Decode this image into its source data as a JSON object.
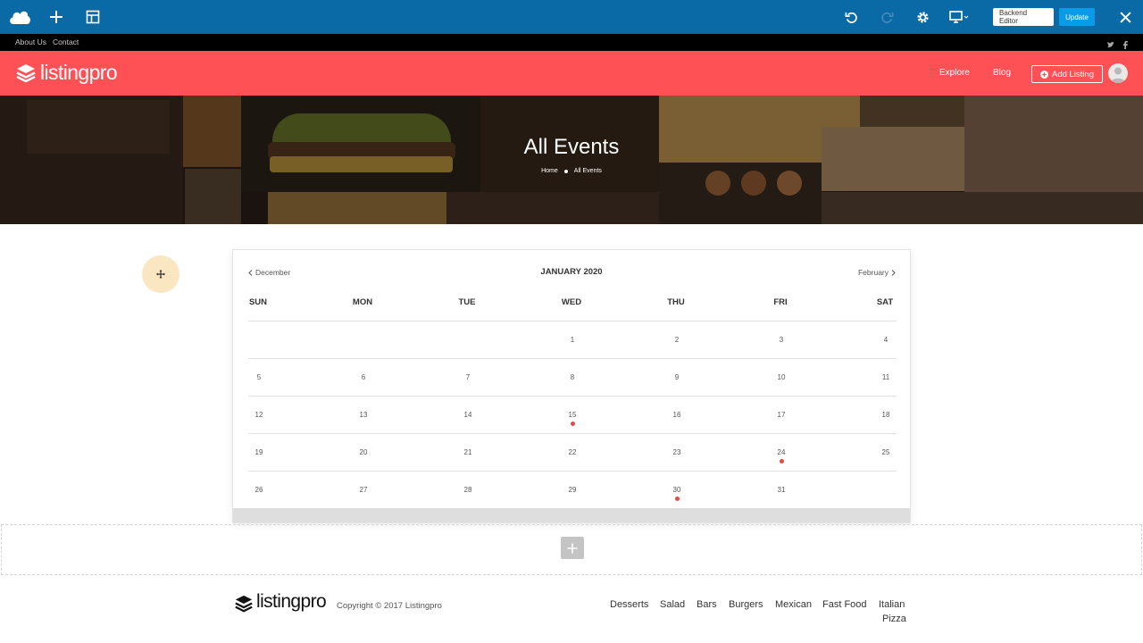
{
  "editor": {
    "backend_label": "Backend Editor",
    "update_label": "Update"
  },
  "topbar": {
    "links": [
      "About Us",
      "Contact"
    ]
  },
  "header": {
    "logo_text": "listingpro",
    "nav": [
      "Explore",
      "Blog"
    ],
    "add_listing_label": "Add Listing"
  },
  "hero": {
    "title": "All Events",
    "breadcrumb": [
      "Home",
      "All Events"
    ]
  },
  "calendar": {
    "prev_label": "December",
    "next_label": "February",
    "month_title": "JANUARY 2020",
    "weekdays": [
      "SUN",
      "MON",
      "TUE",
      "WED",
      "THU",
      "FRI",
      "SAT"
    ],
    "weeks": [
      [
        "",
        "",
        "",
        "1",
        "2",
        "3",
        "4"
      ],
      [
        "5",
        "6",
        "7",
        "8",
        "9",
        "10",
        "11"
      ],
      [
        "12",
        "13",
        "14",
        "15",
        "16",
        "17",
        "18"
      ],
      [
        "19",
        "20",
        "21",
        "22",
        "23",
        "24",
        "25"
      ],
      [
        "26",
        "27",
        "28",
        "29",
        "30",
        "31",
        ""
      ]
    ],
    "event_days": [
      "15",
      "24",
      "30"
    ]
  },
  "footer": {
    "logo_text": "listingpro",
    "copyright": "Copyright © 2017 Listingpro",
    "categories": [
      "Desserts",
      "Salad",
      "Bars",
      "Burgers",
      "Mexican",
      "Fast Food",
      "Italian",
      "Pizza"
    ]
  },
  "colors": {
    "editor_bar": "#0a6aa6",
    "brand": "#fd5156",
    "event_dot": "#e84848",
    "update_button": "#0a9be8"
  }
}
